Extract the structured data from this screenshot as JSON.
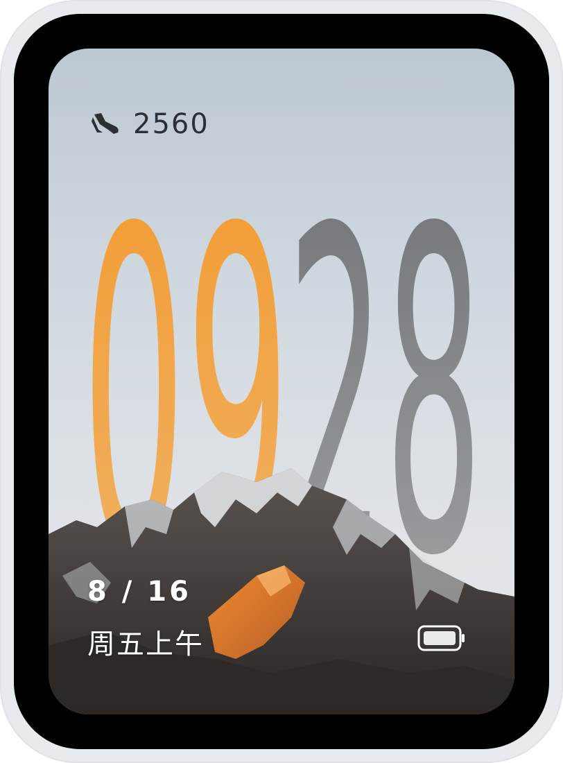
{
  "watch_face": {
    "steps": {
      "icon": "shoe-icon",
      "value": "2560"
    },
    "time": {
      "hour": "09",
      "minute": "28"
    },
    "date": "8 / 16",
    "weekday": "周五上午",
    "battery": {
      "icon": "battery-icon"
    }
  },
  "colors": {
    "hour": "#f2a03d",
    "minute": "#7c7f83",
    "sky_top": "#bcc8d2",
    "sky_bottom": "#e4e6e8",
    "peak_highlight": "#d8823a"
  }
}
